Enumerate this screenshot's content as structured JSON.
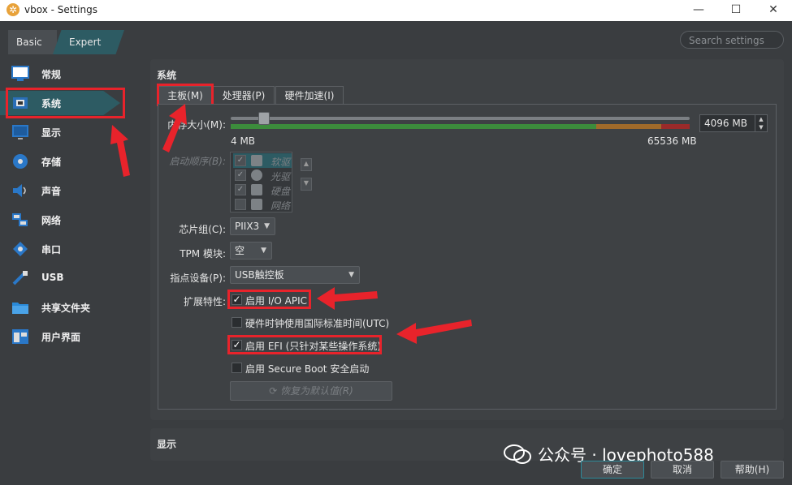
{
  "window": {
    "title": "vbox - Settings",
    "logo": "gear-logo-icon"
  },
  "mode": {
    "basic": "Basic",
    "expert": "Expert"
  },
  "search": {
    "placeholder": "Search settings"
  },
  "sidebar": {
    "items": [
      {
        "label": "常规",
        "icon": "monitor-icon"
      },
      {
        "label": "系统",
        "icon": "chip-icon",
        "selected": true
      },
      {
        "label": "显示",
        "icon": "display-icon"
      },
      {
        "label": "存储",
        "icon": "disk-icon"
      },
      {
        "label": "声音",
        "icon": "speaker-icon"
      },
      {
        "label": "网络",
        "icon": "network-icon"
      },
      {
        "label": "串口",
        "icon": "serial-port-icon"
      },
      {
        "label": "USB",
        "icon": "usb-icon"
      },
      {
        "label": "共享文件夹",
        "icon": "folder-icon"
      },
      {
        "label": "用户界面",
        "icon": "ui-icon"
      }
    ]
  },
  "panel": {
    "title": "系统",
    "tabs": [
      {
        "label": "主板(M)",
        "active": true
      },
      {
        "label": "处理器(P)"
      },
      {
        "label": "硬件加速(I)"
      }
    ],
    "memory": {
      "label": "内存大小(M):",
      "value": "4096 MB",
      "min_label": "4 MB",
      "max_label": "65536 MB",
      "min": 4,
      "max": 65536,
      "current": 4096
    },
    "boot_order": {
      "label": "启动顺序(B):",
      "items": [
        {
          "label": "软驱",
          "checked": true
        },
        {
          "label": "光驱",
          "checked": true
        },
        {
          "label": "硬盘",
          "checked": true
        },
        {
          "label": "网络",
          "checked": false
        }
      ]
    },
    "chipset": {
      "label": "芯片组(C):",
      "value": "PIIX3"
    },
    "tpm": {
      "label": "TPM 模块:",
      "value": "空"
    },
    "pointing": {
      "label": "指点设备(P):",
      "value": "USB触控板"
    },
    "extended": {
      "label": "扩展特性:",
      "io_apic": {
        "label": "启用 I/O APIC",
        "checked": true
      },
      "utc": {
        "label": "硬件时钟使用国际标准时间(UTC)",
        "checked": false
      },
      "efi": {
        "label": "启用 EFI (只针对某些操作系统)",
        "checked": true
      },
      "secure_boot": {
        "label": "启用 Secure Boot 安全启动",
        "checked": false
      }
    },
    "reset_button": "恢复为默认值(R)"
  },
  "display_section": {
    "title": "显示"
  },
  "buttons": {
    "ok": "确定",
    "cancel": "取消",
    "help": "帮助(H)"
  },
  "watermark": {
    "text": "公众号 · lovephoto588"
  },
  "colors": {
    "accent": "#2d5b63",
    "highlight": "#e8232b"
  }
}
